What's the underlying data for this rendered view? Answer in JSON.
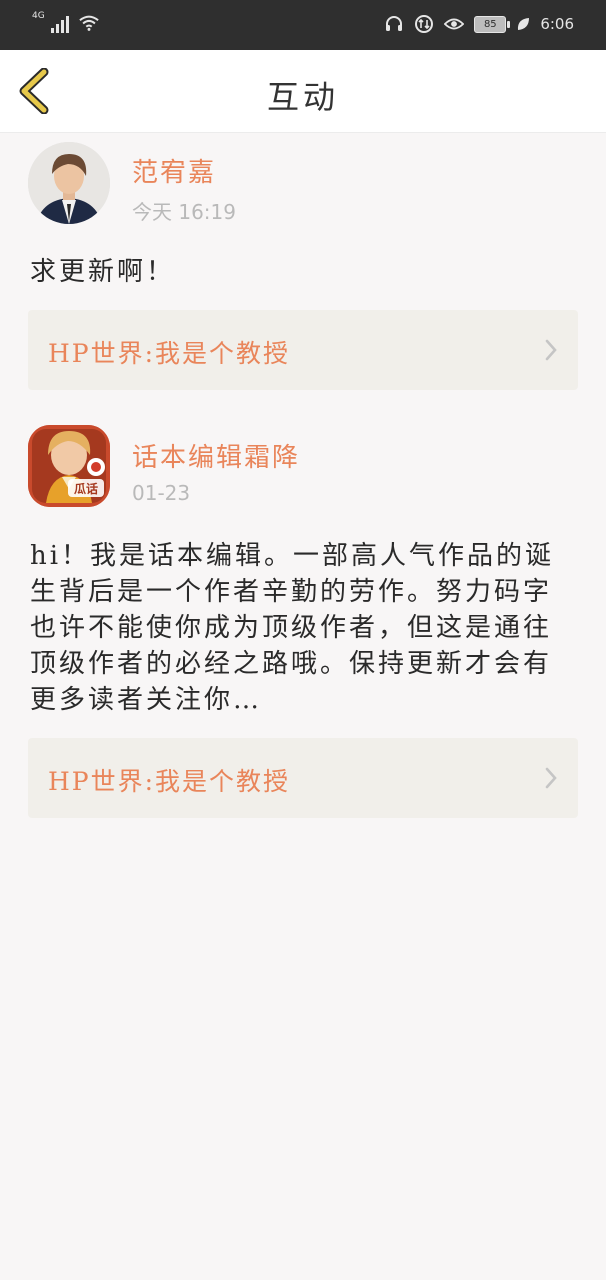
{
  "status_bar": {
    "network": "4G",
    "battery": "85",
    "time": "6:06"
  },
  "header": {
    "title": "互动"
  },
  "posts": [
    {
      "author": "范宥嘉",
      "time": "今天 16:19",
      "content": "求更新啊！",
      "book": "HP世界:我是个教授"
    },
    {
      "author": "话本编辑霜降",
      "time": "01-23",
      "content": "hi！我是话本编辑。一部高人气作品的诞生背后是一个作者辛勤的劳作。努力码字也许不能使你成为顶级作者，但这是通往顶级作者的必经之路哦。保持更新才会有更多读者关注你…",
      "book": "HP世界:我是个教授",
      "avatar_badge": "瓜话"
    }
  ],
  "colors": {
    "accent": "#e9855a",
    "status_bar_bg": "#2f2f2f",
    "page_bg": "#f8f6f6",
    "card_bg": "#f1efea",
    "back_icon": "#e6c84a"
  }
}
